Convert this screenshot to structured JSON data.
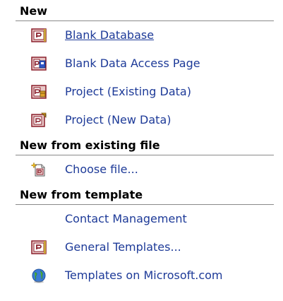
{
  "colors": {
    "link": "#1d3a98",
    "header_rule": "#8a8a8a"
  },
  "sections": [
    {
      "title": "New",
      "items": [
        {
          "label": "Blank Database",
          "icon": "access-database-icon",
          "hover": true
        },
        {
          "label": "Blank Data Access Page",
          "icon": "data-access-page-icon"
        },
        {
          "label": "Project (Existing Data)",
          "icon": "project-existing-data-icon"
        },
        {
          "label": "Project (New Data)",
          "icon": "project-new-data-icon"
        }
      ]
    },
    {
      "title": "New from existing file",
      "items": [
        {
          "label": "Choose file...",
          "icon": "new-from-file-icon"
        }
      ]
    },
    {
      "title": "New from template",
      "items": [
        {
          "label": "Contact Management",
          "icon": ""
        },
        {
          "label": "General Templates...",
          "icon": "templates-icon"
        },
        {
          "label": "Templates on Microsoft.com",
          "icon": "globe-icon"
        }
      ]
    }
  ]
}
